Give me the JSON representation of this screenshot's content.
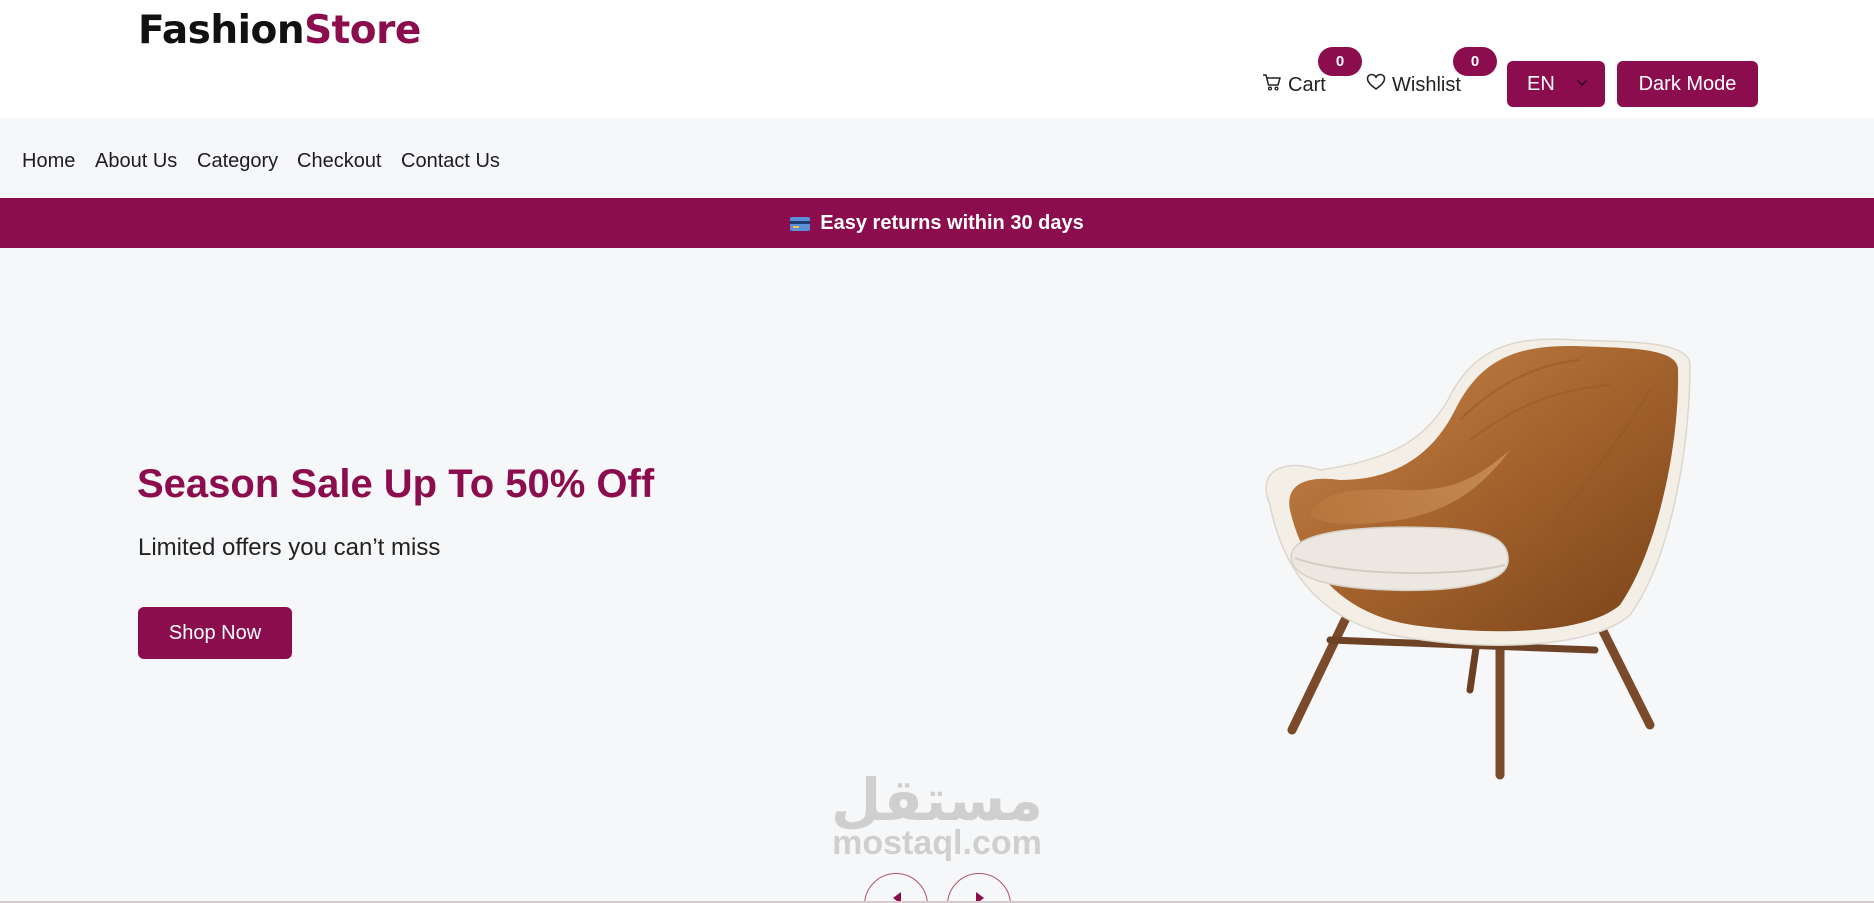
{
  "brand": {
    "part1": "Fashion",
    "part2": "Store",
    "accent": "#8c0d4e"
  },
  "header": {
    "cart_label": "Cart",
    "cart_count": "0",
    "wishlist_label": "Wishlist",
    "wishlist_count": "0",
    "language": "EN",
    "dark_mode_label": "Dark Mode"
  },
  "nav": {
    "items": [
      {
        "label": "Home"
      },
      {
        "label": "About Us"
      },
      {
        "label": "Category"
      },
      {
        "label": "Checkout"
      },
      {
        "label": "Contact Us"
      }
    ]
  },
  "promo": {
    "icon": "credit-card-icon",
    "text": "Easy returns within 30 days"
  },
  "hero": {
    "title": "Season Sale Up To 50% Off",
    "subtitle": "Limited offers you can’t miss",
    "cta_label": "Shop Now",
    "image": "armchair"
  },
  "watermark": {
    "arabic": "مستقل",
    "latin": "mostaql.com"
  },
  "icons": {
    "cart": "cart-icon",
    "wishlist": "heart-icon",
    "language": "chevron-down-icon"
  }
}
